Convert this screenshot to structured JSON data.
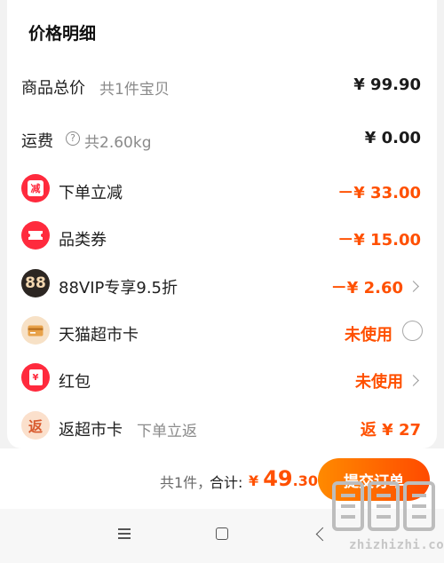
{
  "title": "价格明细",
  "rows": [
    {
      "label": "商品总价",
      "sub": "共1件宝贝",
      "value": "¥ 99.90"
    },
    {
      "label": "运费",
      "sub": "共2.60kg",
      "value": "¥ 0.00"
    },
    {
      "icon_text": "减",
      "label": "下单立减",
      "value": "－¥ 33.00"
    },
    {
      "label": "品类券",
      "value": "－¥ 15.00"
    },
    {
      "icon_text": "88",
      "label": "88VIP专享9.5折",
      "value": "－¥ 2.60"
    },
    {
      "label": "天猫超市卡",
      "value": "未使用"
    },
    {
      "icon_text": "¥",
      "label": "红包",
      "value": "未使用"
    },
    {
      "icon_text": "返",
      "label": "返超市卡",
      "sub": "下单立返",
      "value": "返 ¥ 27"
    }
  ],
  "bottom": {
    "count": "共1件，",
    "total_label": "合计:",
    "currency": "¥",
    "total_int": "49",
    "total_dec": ".30",
    "submit": "提交订单"
  },
  "watermark": {
    "text": "zhizhizhi.com"
  },
  "colors": {
    "accent": "#ff5000",
    "badge_red": "#ff2a3d",
    "button_start": "#ff8a00",
    "button_end": "#ff4a00"
  },
  "icons": [
    "help-circle-icon",
    "discount-icon",
    "coupon-icon",
    "vip-88-icon",
    "supermarket-card-icon",
    "red-packet-icon",
    "cashback-icon",
    "chevron-right-icon",
    "radio-icon",
    "menu-icon",
    "home-icon",
    "back-icon"
  ]
}
